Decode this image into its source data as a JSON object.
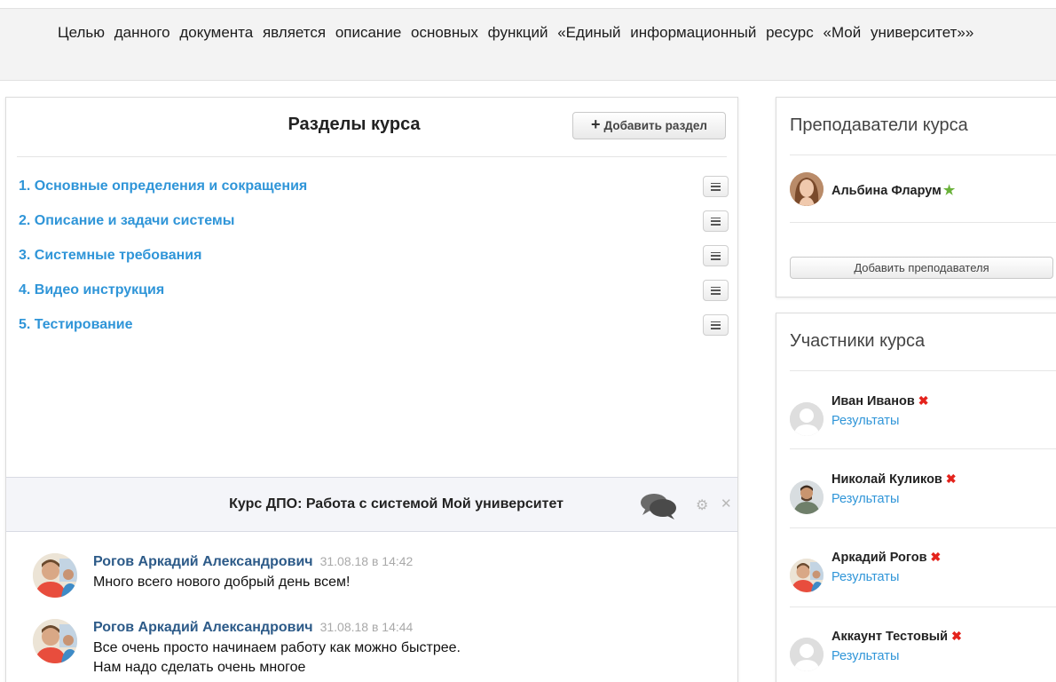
{
  "document": {
    "intro_text": "Целью данного документа является описание основных функций «Единый информационный ресурс «Мой университет»»"
  },
  "sections_panel": {
    "title": "Разделы курса",
    "add_button_label": "Добавить раздел",
    "items": [
      {
        "label": "1. Основные определения и сокращения"
      },
      {
        "label": "2. Описание и задачи системы"
      },
      {
        "label": "3. Системные требования"
      },
      {
        "label": "4. Видео инструкция"
      },
      {
        "label": "5. Тестирование"
      }
    ]
  },
  "chat": {
    "title": "Курс ДПО: Работа с системой Мой университет",
    "messages": [
      {
        "author": "Рогов Аркадий Александрович",
        "time": "31.08.18 в 14:42",
        "text": "Много всего нового добрый день всем!"
      },
      {
        "author": "Рогов Аркадий Александрович",
        "time": "31.08.18 в 14:44",
        "text": "Все очень просто начинаем работу как можно быстрее.\nНам надо сделать очень многое"
      }
    ]
  },
  "teachers_panel": {
    "title": "Преподаватели курса",
    "teacher_name": "Альбина Фларум",
    "add_button_label": "Добавить преподавателя"
  },
  "members_panel": {
    "title": "Участники курса",
    "results_label": "Результаты",
    "members": [
      {
        "name": "Иван Иванов"
      },
      {
        "name": "Николай Куликов"
      },
      {
        "name": "Аркадий Рогов"
      },
      {
        "name": "Аккаунт Тестовый"
      }
    ]
  },
  "icons": {
    "plus": "plus-icon",
    "list": "list-icon",
    "chat": "chat-bubbles-icon",
    "gear": "gear-icon",
    "close": "close-icon",
    "star": "star-icon",
    "remove": "remove-icon"
  },
  "colors": {
    "link_blue": "#2f95d8",
    "author_blue": "#2c5a88",
    "star_green": "#6ab23a",
    "remove_red": "#e4231c"
  }
}
